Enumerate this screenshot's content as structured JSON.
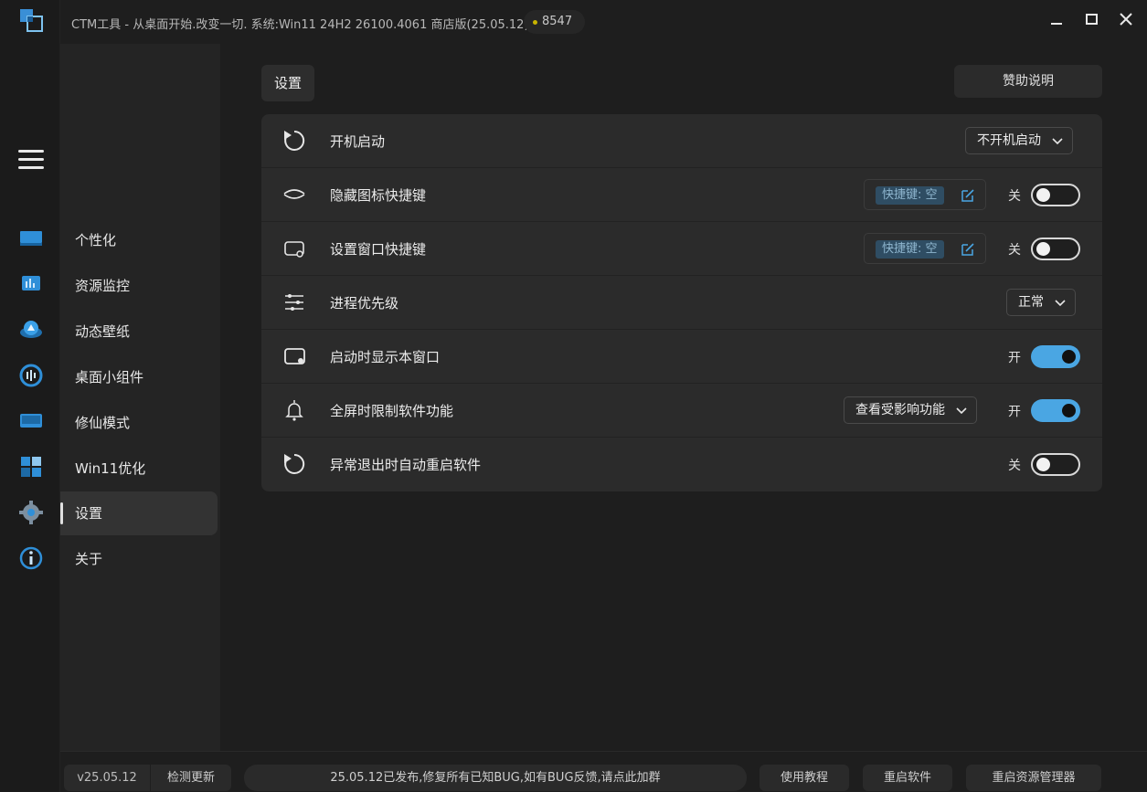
{
  "app": {
    "title": "CTM工具 - 从桌面开始.改变一切. 系统:Win11 24H2 26100.4061 商店版(25.05.12)",
    "coins": "8547"
  },
  "rail": {
    "icons": [
      "menu-icon",
      "display-icon",
      "monitor-chart-icon",
      "wallpaper-icon",
      "widget-gauge-icon",
      "mode-screen-icon",
      "win11-tiles-icon",
      "settings-gear-icon",
      "about-info-icon"
    ]
  },
  "nav": {
    "items": [
      {
        "label": "个性化"
      },
      {
        "label": "资源监控"
      },
      {
        "label": "动态壁纸"
      },
      {
        "label": "桌面小组件"
      },
      {
        "label": "修仙模式"
      },
      {
        "label": "Win11优化"
      },
      {
        "label": "设置"
      },
      {
        "label": "关于"
      }
    ],
    "active": "设置"
  },
  "main": {
    "tab_label": "设置",
    "sponsor_label": "赞助说明",
    "rows": [
      {
        "label": "开机启动",
        "icon": "startup-icon",
        "dropdown": "不开机启动"
      },
      {
        "label": "隐藏图标快捷键",
        "icon": "eye-closed-icon",
        "hotkey": "快捷键: 空",
        "switch_label": "关",
        "switch_on": false
      },
      {
        "label": "设置窗口快捷键",
        "icon": "window-hotkey-icon",
        "hotkey": "快捷键: 空",
        "switch_label": "关",
        "switch_on": false
      },
      {
        "label": "进程优先级",
        "icon": "sliders-icon",
        "dropdown": "正常"
      },
      {
        "label": "启动时显示本窗口",
        "icon": "window-dot-icon",
        "switch_label": "开",
        "switch_on": true
      },
      {
        "label": "全屏时限制软件功能",
        "icon": "bell-icon",
        "dropdown": "查看受影响功能",
        "switch_label": "开",
        "switch_on": true
      },
      {
        "label": "异常退出时自动重启软件",
        "icon": "restart-icon",
        "switch_label": "关",
        "switch_on": false
      }
    ]
  },
  "footer": {
    "version": "v25.05.12",
    "check_update": "检测更新",
    "notice": "25.05.12已发布,修复所有已知BUG,如有BUG反馈,请点此加群",
    "tutorial": "使用教程",
    "restart": "重启软件",
    "restart_explorer": "重启资源管理器"
  },
  "colors": {
    "accent": "#4aa6e3",
    "background": "#1e1e1e",
    "panel": "#2b2b2b"
  }
}
